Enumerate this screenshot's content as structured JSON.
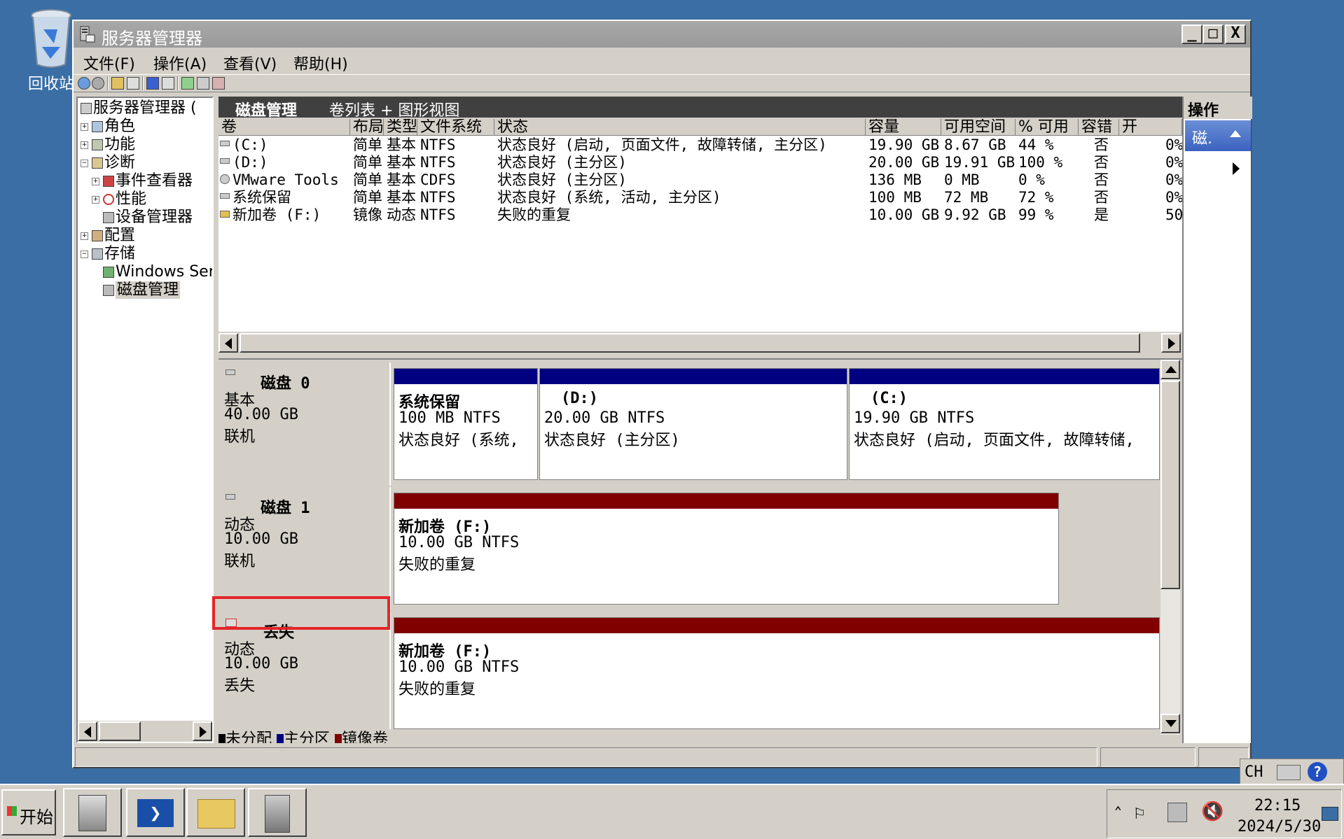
{
  "desktop": {
    "recycle_label": "回收站"
  },
  "window": {
    "title": "服务器管理器",
    "min_btn": "_",
    "max_btn": "□",
    "close_btn": "X",
    "menu": [
      "文件(F)",
      "操作(A)",
      "查看(V)",
      "帮助(H)"
    ]
  },
  "tree": {
    "items": [
      {
        "label": "服务器管理器 (",
        "icon": "server-manager-icon"
      },
      {
        "label": "角色",
        "icon": "roles-icon"
      },
      {
        "label": "功能",
        "icon": "features-icon"
      },
      {
        "label": "诊断",
        "icon": "diagnostics-icon"
      },
      {
        "label": "事件查看器",
        "icon": "event-viewer-icon"
      },
      {
        "label": "性能",
        "icon": "performance-icon"
      },
      {
        "label": "设备管理器",
        "icon": "device-manager-icon"
      },
      {
        "label": "配置",
        "icon": "configuration-icon"
      },
      {
        "label": "存储",
        "icon": "storage-icon"
      },
      {
        "label": "Windows Ser",
        "icon": "backup-icon"
      },
      {
        "label": "磁盘管理",
        "icon": "disk-management-icon"
      }
    ]
  },
  "center": {
    "title": "磁盘管理",
    "view": "卷列表 + 图形视图",
    "columns": [
      "卷",
      "布局",
      "类型",
      "文件系统",
      "状态",
      "容量",
      "可用空间",
      "% 可用",
      "容错",
      "开"
    ],
    "rows": [
      [
        "(C:)",
        "简单",
        "基本",
        "NTFS",
        "状态良好 (启动, 页面文件, 故障转储, 主分区)",
        "19.90 GB",
        "8.67 GB",
        "44 %",
        "否",
        "0%"
      ],
      [
        "(D:)",
        "简单",
        "基本",
        "NTFS",
        "状态良好 (主分区)",
        "20.00 GB",
        "19.91 GB",
        "100 %",
        "否",
        "0%"
      ],
      [
        "VMware Tools (E:)",
        "简单",
        "基本",
        "CDFS",
        "状态良好 (主分区)",
        "136 MB",
        "0 MB",
        "0 %",
        "否",
        "0%"
      ],
      [
        "系统保留",
        "简单",
        "基本",
        "NTFS",
        "状态良好 (系统, 活动, 主分区)",
        "100 MB",
        "72 MB",
        "72 %",
        "否",
        "0%"
      ],
      [
        "新加卷 (F:)",
        "镜像",
        "动态",
        "NTFS",
        "失败的重复",
        "10.00 GB",
        "9.92 GB",
        "99 %",
        "是",
        "50"
      ]
    ]
  },
  "disks": [
    {
      "name": "磁盘 0",
      "type": "基本",
      "size": "40.00 GB",
      "state": "联机",
      "volumes": [
        {
          "name": "系统保留",
          "info": "100 MB NTFS",
          "status": "状态良好 (系统,"
        },
        {
          "name": "(D:)",
          "info": "20.00 GB NTFS",
          "status": "状态良好 (主分区)"
        },
        {
          "name": "(C:)",
          "info": "19.90 GB NTFS",
          "status": "状态良好 (启动, 页面文件, 故障转储,"
        }
      ]
    },
    {
      "name": "磁盘 1",
      "type": "动态",
      "size": "10.00 GB",
      "state": "联机",
      "volumes": [
        {
          "name": "新加卷 (F:)",
          "info": "10.00 GB NTFS",
          "status": "失败的重复"
        }
      ]
    },
    {
      "name": "丢失",
      "type": "动态",
      "size": "10.00 GB",
      "state": "丢失",
      "volumes": [
        {
          "name": "新加卷 (F:)",
          "info": "10.00 GB NTFS",
          "status": "失败的重复"
        }
      ]
    }
  ],
  "legend": [
    "未分配",
    "主分区",
    "镜像卷"
  ],
  "colors": {
    "primary": "#000080",
    "mirror": "#800000",
    "unallocated": "#000000",
    "highlight": "#e3262b"
  },
  "actions": {
    "header": "操作",
    "item": "磁."
  },
  "taskbar": {
    "start": "开始",
    "time": "22:15",
    "date": "2024/5/30",
    "lang": "CH"
  }
}
